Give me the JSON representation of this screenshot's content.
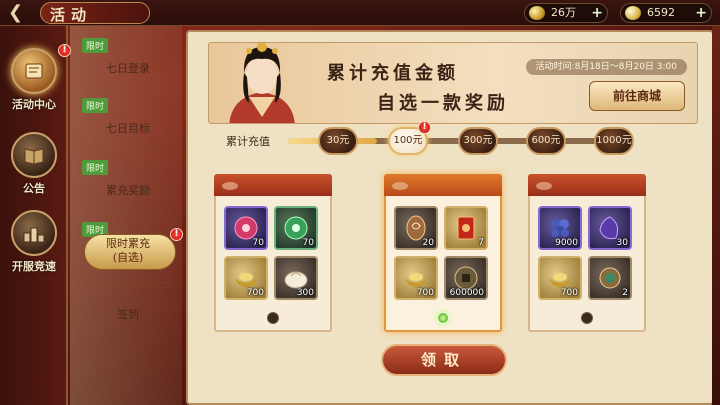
{
  "header": {
    "title": "活动",
    "copper": "26万",
    "silver": "6592"
  },
  "left_nav": [
    {
      "label": "活动中心",
      "icon": "scroll-icon",
      "alert": "!"
    },
    {
      "label": "公告",
      "icon": "book-icon",
      "alert": ""
    },
    {
      "label": "开服竞速",
      "icon": "podium-icon",
      "alert": ""
    }
  ],
  "submenu": [
    {
      "tag": "限时",
      "label": "七日登录"
    },
    {
      "tag": "限时",
      "label": "七日目标"
    },
    {
      "tag": "限时",
      "label": "累充奖励"
    },
    {
      "tag": "限时",
      "label": "限时累充\n(自选)"
    },
    {
      "tag": "",
      "label": "签到"
    }
  ],
  "banner": {
    "title_line1": "累计充值金额",
    "title_line2": "自选一款奖励",
    "time": "活动时间:8月18日～8月20日 3:00",
    "shop_button": "前往商城"
  },
  "progress": {
    "label": "累计充值",
    "nodes": [
      "30元",
      "100元",
      "300元",
      "600元",
      "1000元"
    ],
    "active_index": 1,
    "fill_fraction": 0.27
  },
  "cards": [
    {
      "items": [
        {
          "icon": "red-orb-icon",
          "count": "70"
        },
        {
          "icon": "green-orb-icon",
          "count": "70"
        },
        {
          "icon": "gold-ingot-icon",
          "count": "700"
        },
        {
          "icon": "bun-icon",
          "count": "300"
        }
      ],
      "selected": false
    },
    {
      "items": [
        {
          "icon": "copper-coin-icon",
          "count": "20"
        },
        {
          "icon": "red-card-icon",
          "count": "7"
        },
        {
          "icon": "gold-ingot-icon",
          "count": "700"
        },
        {
          "icon": "copper-money-icon",
          "count": "600000"
        }
      ],
      "selected": true
    },
    {
      "items": [
        {
          "icon": "blue-grapes-icon",
          "count": "9000"
        },
        {
          "icon": "purple-stone-icon",
          "count": "30"
        },
        {
          "icon": "gold-ingot-icon",
          "count": "700"
        },
        {
          "icon": "ornament-ball-icon",
          "count": "2"
        }
      ],
      "selected": false
    }
  ],
  "claim_button": "领取",
  "colors": {
    "accent": "#c95a3a",
    "panel": "#efe2c4",
    "select": "#6cc03a"
  }
}
